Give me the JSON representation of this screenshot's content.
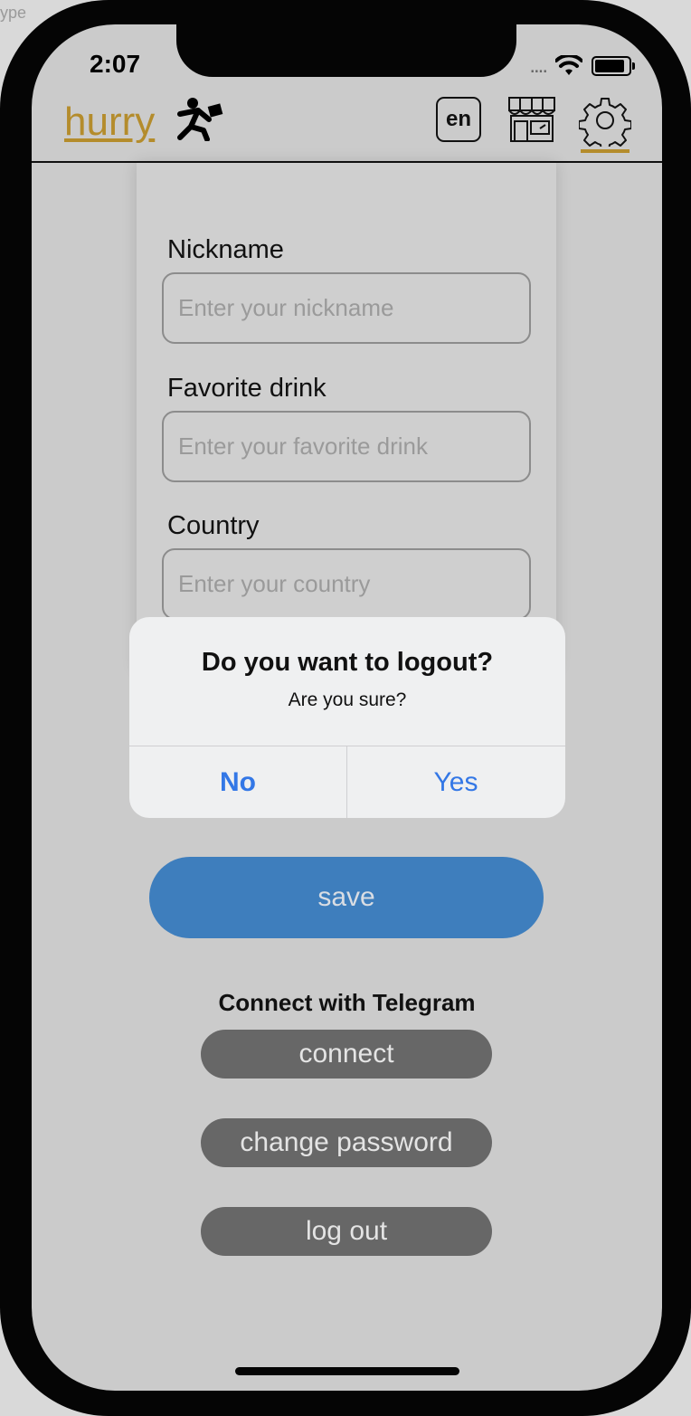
{
  "corner": {
    "text": "ype"
  },
  "status_bar": {
    "time": "2:07"
  },
  "header": {
    "logo_text": "hurry",
    "language_label": "en"
  },
  "form": {
    "fields": [
      {
        "label": "Nickname",
        "placeholder": "Enter your nickname",
        "value": ""
      },
      {
        "label": "Favorite drink",
        "placeholder": "Enter your favorite drink",
        "value": ""
      },
      {
        "label": "Country",
        "placeholder": "Enter your country",
        "value": ""
      }
    ]
  },
  "dialog": {
    "title": "Do you want to logout?",
    "message": "Are you sure?",
    "no_label": "No",
    "yes_label": "Yes"
  },
  "actions": {
    "save_label": "save",
    "telegram_heading": "Connect with Telegram",
    "connect_label": "connect",
    "change_password_label": "change password",
    "logout_label": "log out"
  },
  "colors": {
    "brand_gold": "#b48c2c",
    "save_blue": "#3e7ebd",
    "dialog_button_blue": "#3377e6",
    "pill_gray": "#676767",
    "background": "#cbcbcb"
  },
  "icons": [
    "running-man-icon",
    "storefront-icon",
    "gear-icon",
    "wifi-icon",
    "battery-icon"
  ]
}
